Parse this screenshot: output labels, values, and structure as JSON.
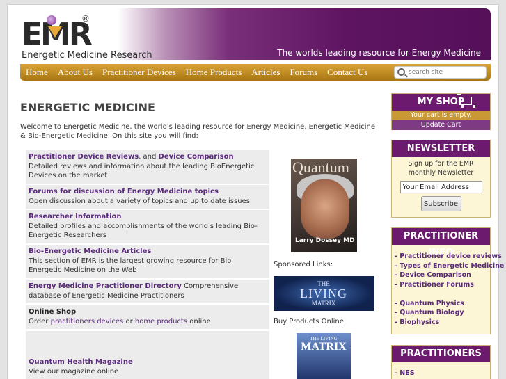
{
  "header": {
    "logo_text": "EMR",
    "logo_reg": "®",
    "logo_sub": "Energetic Medicine Research",
    "tagline": "The worlds leading resource for Energy Medicine"
  },
  "nav": {
    "items": [
      {
        "label": "Home"
      },
      {
        "label": "About Us"
      },
      {
        "label": "Practitioner Devices"
      },
      {
        "label": "Home Products"
      },
      {
        "label": "Articles"
      },
      {
        "label": "Forums"
      },
      {
        "label": "Contact Us"
      }
    ],
    "search_placeholder": "search site"
  },
  "main": {
    "title": "ENERGETIC MEDICINE",
    "intro": "Welcome to Energetic Medicine, the world's leading resource for Energy Medicine, Energetic Medicine & Bio-Energetic Medicine. On this site you will find:",
    "sections": [
      {
        "title": "Practitioner Device Reviews",
        "mid": ", and ",
        "title2": "Device Comparison",
        "desc": "Detailed reviews and information about the leading BioEnergetic Devices on the market"
      },
      {
        "title": "Forums for discussion of Energy Medicine topics",
        "desc": "Open discussion about a variety of topics and up to date issues"
      },
      {
        "title": "Researcher Information",
        "desc": "Detailed profiles and accomplishments of the world's leading Bio-Energetic Researchers"
      },
      {
        "title": "Bio-Energetic Medicine Articles",
        "desc": "This section of EMR is the largest growing resource for Bio Energetic Medicine on the Web"
      },
      {
        "title": "Energy Medicine Practitioner Directory",
        "desc": " Comprehensive database of Energetic Medicine Practitioners"
      },
      {
        "title": "Online Shop",
        "desc_pre": "Order ",
        "link1": "practitioners devices",
        "desc_mid": " or ",
        "link2": "home products",
        "desc_post": " online"
      },
      {
        "title": "Quantum Health Magazine",
        "desc": "View our magazine online"
      }
    ]
  },
  "media": {
    "magazine_title": "Quantum",
    "magazine_name": "Larry Dossey MD",
    "sponsored_label": "Sponsored Links:",
    "living_a": "THE",
    "living_b": "LIVING",
    "living_c": "MATRIX",
    "buy_label": "Buy Products Online:",
    "book_a": "THE LIVING",
    "book_b": "MATRIX"
  },
  "sidebar": {
    "shop": {
      "title": "MY SHOP",
      "cart_status": "Your cart is empty.",
      "update_cart": "Update Cart"
    },
    "newsletter": {
      "title": "NEWSLETTER",
      "text": "Sign up for the EMR monthly Newsletter",
      "email_value": "Your Email Address",
      "subscribe": "Subscribe"
    },
    "practitioner_info": {
      "title": "PRACTITIONER INFO",
      "links": [
        "- Practitioner device reviews",
        "- Types of Energetic Medicine",
        "- Device Comparison",
        "- Practitioner Forums"
      ],
      "links2": [
        "- Quantum Physics",
        "- Quantum Biology",
        "- Biophysics"
      ]
    },
    "practitioners": {
      "title": "PRACTITIONERS",
      "links": [
        "- NES"
      ]
    }
  }
}
